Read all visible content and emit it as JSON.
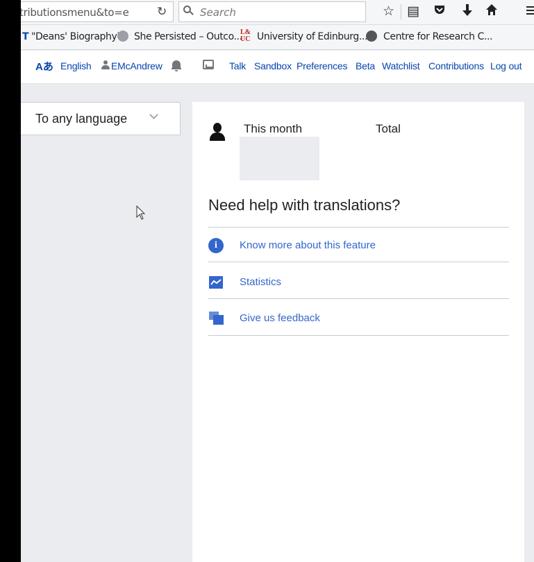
{
  "browser": {
    "url_text": "tributionsmenu&to=e",
    "search_placeholder": "Search",
    "icons": [
      "reload-icon",
      "star-icon",
      "reader-icon",
      "pocket-icon",
      "download-icon",
      "home-icon",
      "menu-icon"
    ]
  },
  "bookmarks": {
    "items": [
      {
        "label": "\"Deans' Biography\"",
        "icon": "t-icon"
      },
      {
        "label": "She Persisted – Outco...",
        "icon": "globe-icon"
      },
      {
        "label": "University of Edinburg...",
        "icon": "luc-icon"
      },
      {
        "label": "Centre for Research C...",
        "icon": "badge-icon"
      }
    ],
    "t_glyph": "T",
    "luc_glyph_top": "L&",
    "luc_glyph_bottom": "UC"
  },
  "personal": {
    "language_icon": "Aあ",
    "language": "English",
    "username": "EMcAndrew",
    "links": [
      "Talk",
      "Sandbox",
      "Preferences",
      "Beta",
      "Watchlist",
      "Contributions",
      "Log out"
    ]
  },
  "language_selector": {
    "label": "To any language"
  },
  "panel": {
    "col_this_month": "This month",
    "col_total": "Total",
    "help_title": "Need help with translations?",
    "info_glyph": "i",
    "links": [
      "Know more about this feature",
      "Statistics",
      "Give us feedback"
    ]
  },
  "colors": {
    "link": "#0645ad",
    "panel_link": "#3366cc",
    "background": "#eaecf0"
  }
}
